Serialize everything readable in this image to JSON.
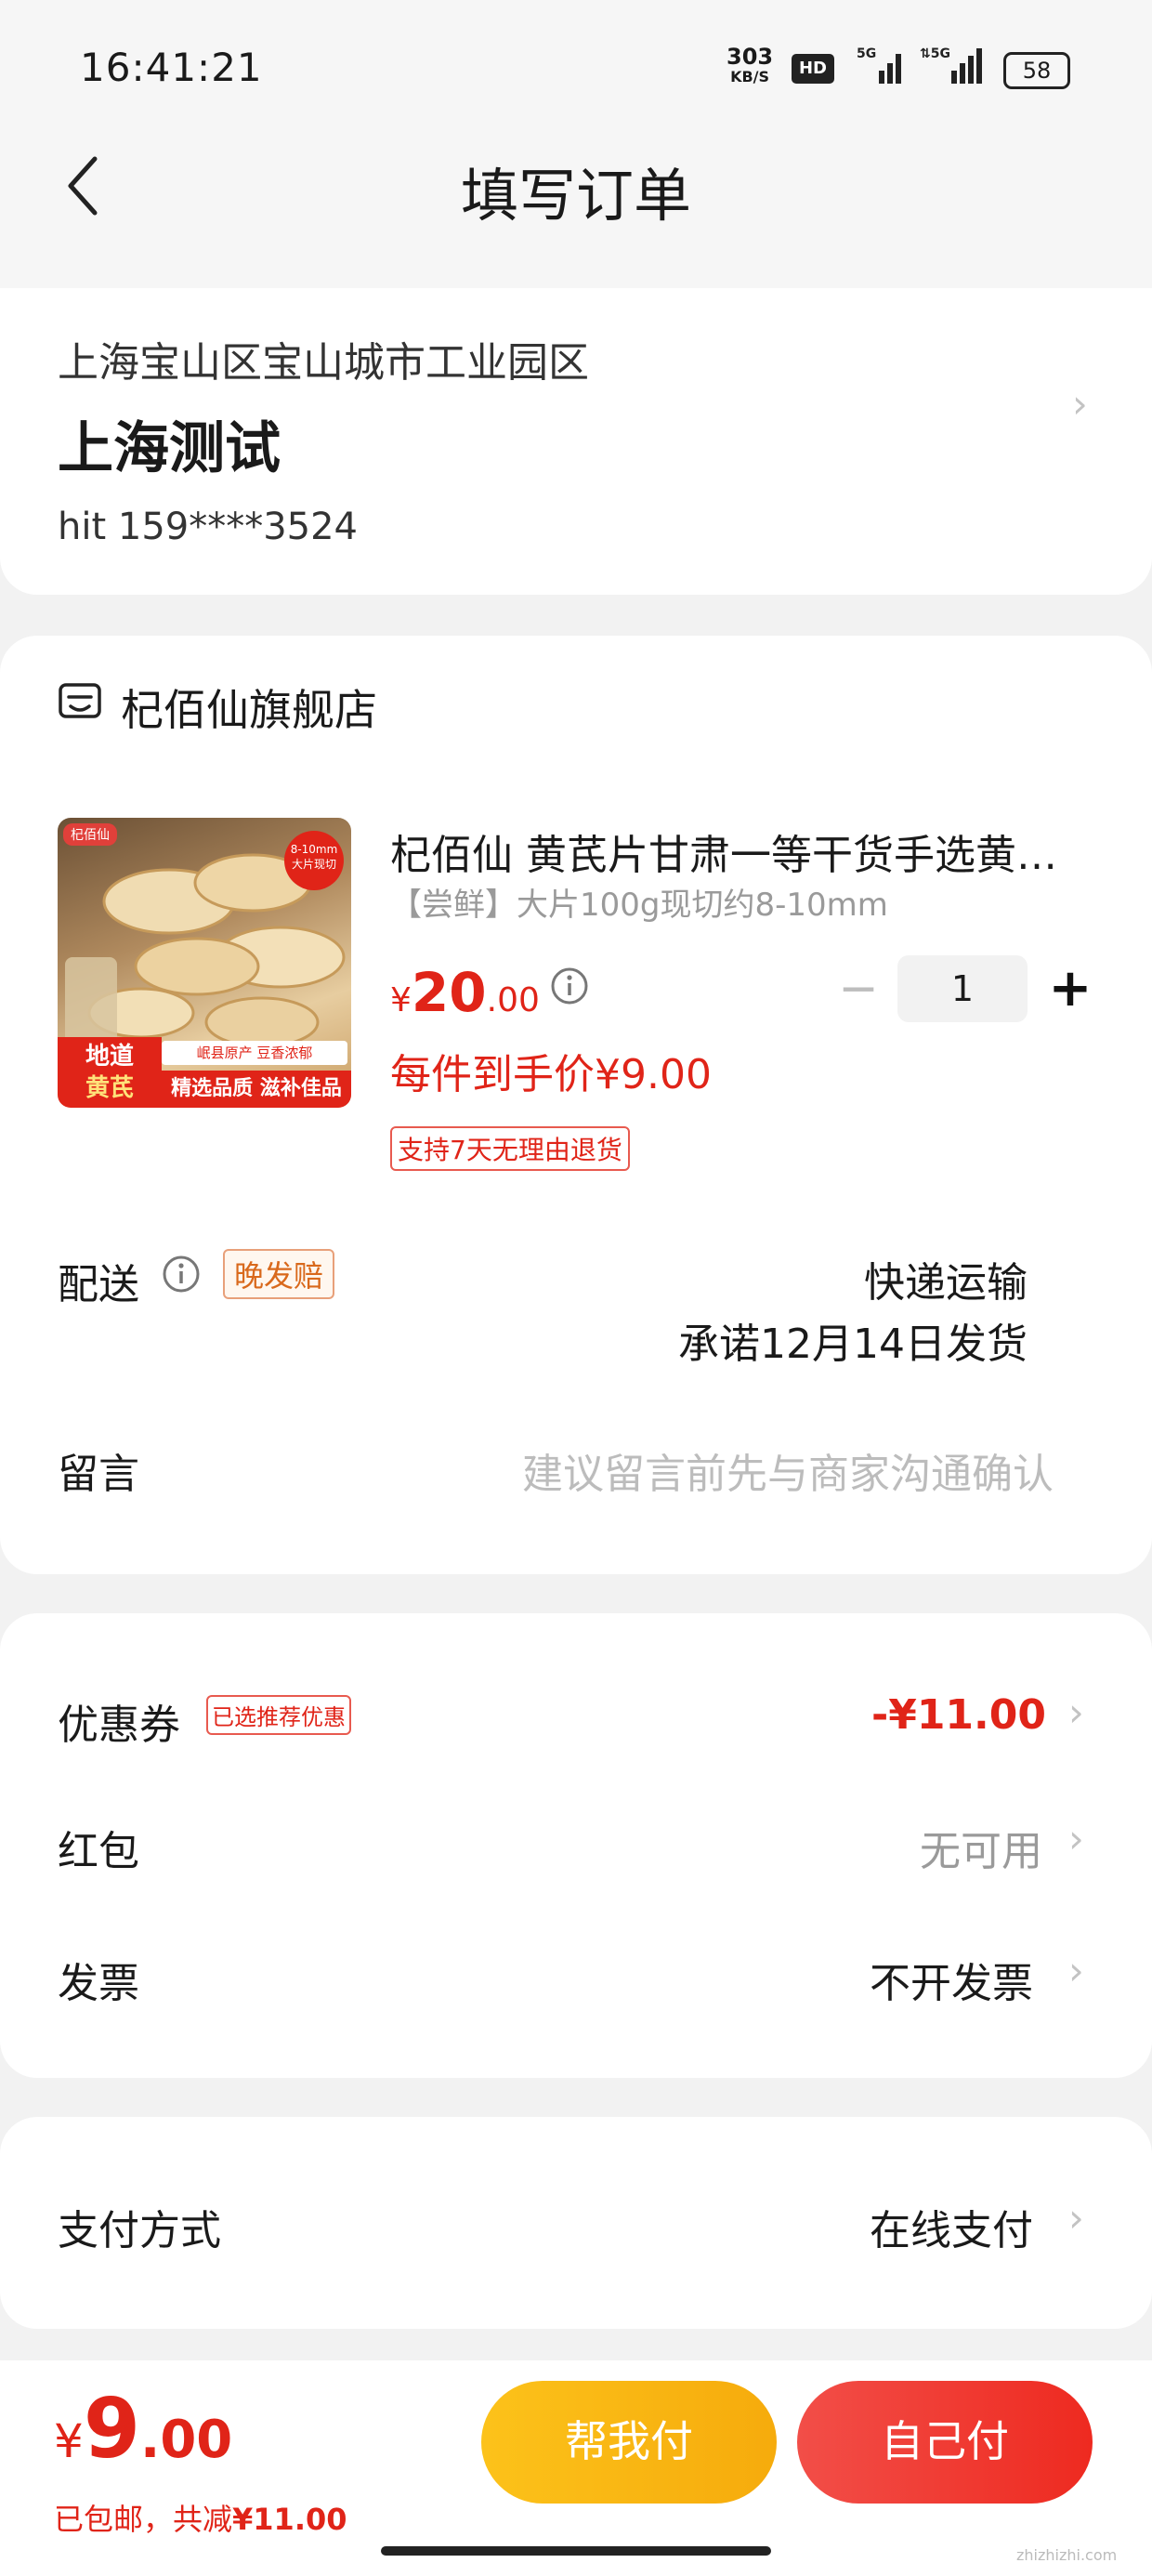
{
  "status_bar": {
    "time": "16:41:21",
    "net_speed": "303",
    "net_unit": "KB/S",
    "hd": "HD",
    "sig1": "5G",
    "sig2": "5G",
    "battery": "58"
  },
  "header": {
    "title": "填写订单"
  },
  "address": {
    "region": "上海宝山区宝山城市工业园区",
    "detail": "上海测试",
    "contact": "hit  159****3524"
  },
  "store": {
    "name": "杞佰仙旗舰店"
  },
  "product": {
    "title": "杞佰仙 黄芪片甘肃一等干货手选黄…",
    "spec": "【尝鲜】大片100g现切约8-10mm",
    "price_symbol": "¥",
    "price_int": "20",
    "price_dec": ".00",
    "final_price": "每件到手价¥9.00",
    "return_tag": "支持7天无理由退货",
    "quantity": "1",
    "image_badge": "8-10mm 大片现切",
    "image_brand": "杞佰仙",
    "image_tag1": "地道",
    "image_tag2": "黄芪",
    "image_caption_small": "岷县原产  豆香浓郁",
    "image_caption": "精选品质 滋补佳品"
  },
  "delivery": {
    "label": "配送",
    "tag": "晚发赔",
    "method": "快递运输",
    "promise": "承诺12月14日发货"
  },
  "message": {
    "label": "留言",
    "placeholder": "建议留言前先与商家沟通确认"
  },
  "discounts": {
    "coupon_label": "优惠券",
    "coupon_tag": "已选推荐优惠",
    "coupon_value": "-¥11.00",
    "redpacket_label": "红包",
    "redpacket_value": "无可用",
    "invoice_label": "发票",
    "invoice_value": "不开发票"
  },
  "payment": {
    "label": "支付方式",
    "value": "在线支付"
  },
  "footer": {
    "total_symbol": "¥",
    "total_int": "9",
    "total_dec": ".00",
    "summary_prefix": "已包邮，共减",
    "summary_value": "¥11.00",
    "help_pay": "帮我付",
    "self_pay": "自己付"
  },
  "watermark": "zhizhizhi.com",
  "colors": {
    "accent_red": "#e02418",
    "help_btn": "#fbb414",
    "self_btn": "#f23c32"
  }
}
